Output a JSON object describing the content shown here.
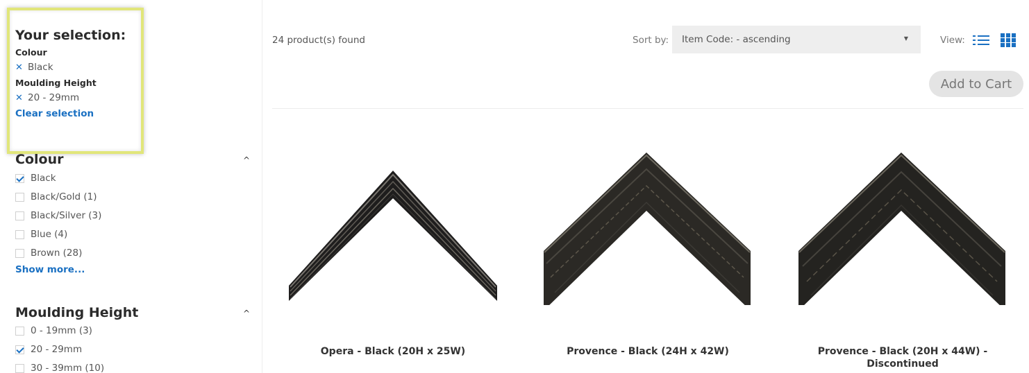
{
  "sidebar": {
    "selection": {
      "title": "Your selection:",
      "groups": [
        {
          "name": "Colour",
          "value": "Black"
        },
        {
          "name": "Moulding Height",
          "value": "20 - 29mm"
        }
      ],
      "clear_label": "Clear selection",
      "highlight_color": "#e1e67a"
    },
    "colour_facet": {
      "title": "Colour",
      "items": [
        {
          "label": "Black",
          "checked": true
        },
        {
          "label": "Black/Gold (1)",
          "checked": false
        },
        {
          "label": "Black/Silver (3)",
          "checked": false
        },
        {
          "label": "Blue (4)",
          "checked": false
        },
        {
          "label": "Brown (28)",
          "checked": false
        }
      ],
      "show_more": "Show more..."
    },
    "height_facet": {
      "title": "Moulding Height",
      "items": [
        {
          "label": "0 - 19mm (3)",
          "checked": false
        },
        {
          "label": "20 - 29mm",
          "checked": true
        },
        {
          "label": "30 - 39mm (10)",
          "checked": false
        }
      ]
    }
  },
  "toolbar": {
    "found": "24 product(s) found",
    "sort_label": "Sort by:",
    "sort_value": "Item Code: - ascending",
    "view_label": "View:",
    "add_to_cart": "Add to Cart",
    "accent": "#1a70c2"
  },
  "products": [
    {
      "name": "Opera - Black (20H x 25W)"
    },
    {
      "name": "Provence - Black (24H x 42W)"
    },
    {
      "name": "Provence - Black (20H x 44W) - Discontinued"
    }
  ]
}
